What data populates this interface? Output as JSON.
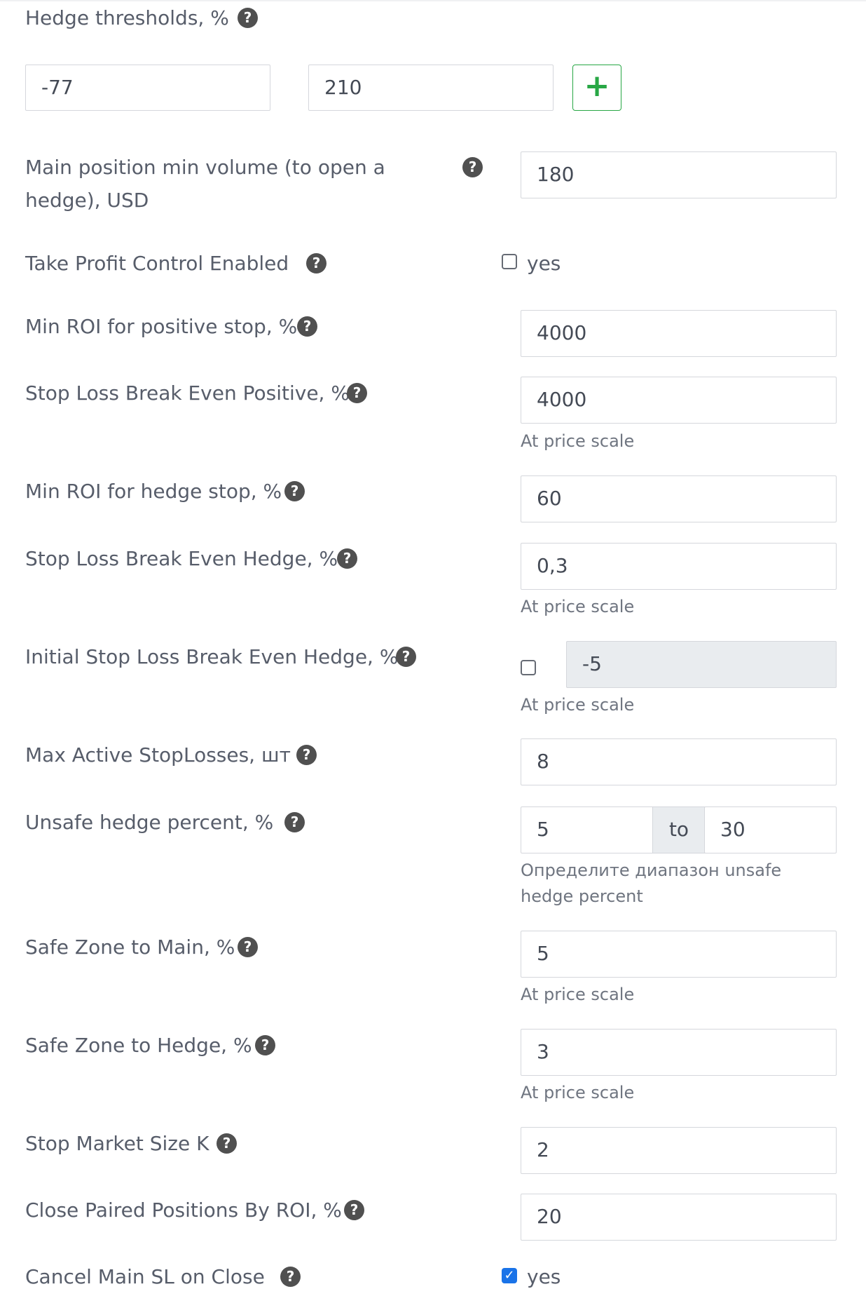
{
  "form": {
    "hedge_thresholds": {
      "label": "Hedge thresholds, %",
      "help_icon": "question-circle-icon",
      "value_1": "-77",
      "value_2": "210",
      "add_button_icon": "plus-icon",
      "add_button_color": "#28a745"
    },
    "main_position_min_volume": {
      "label": "Main position min volume (to open a hedge), USD",
      "value": "180"
    },
    "take_profit_control": {
      "label": "Take Profit Control Enabled",
      "checked": false,
      "checkbox_label": "yes"
    },
    "min_roi_positive_stop": {
      "label": "Min ROI for positive stop, %",
      "value": "4000"
    },
    "stop_loss_be_positive": {
      "label": "Stop Loss Break Even Positive, %",
      "value": "4000",
      "hint": "At price scale"
    },
    "min_roi_hedge_stop": {
      "label": "Min ROI for hedge stop, %",
      "value": "60"
    },
    "stop_loss_be_hedge": {
      "label": "Stop Loss Break Even Hedge, %",
      "value": "0,3",
      "hint": "At price scale"
    },
    "initial_stop_loss_be_hedge": {
      "label": "Initial Stop Loss Break Even Hedge, %",
      "checked": false,
      "value": "-5",
      "disabled": true,
      "hint": "At price scale"
    },
    "max_active_stoplosses": {
      "label": "Max Active StopLosses, шт",
      "value": "8"
    },
    "unsafe_hedge_percent": {
      "label": "Unsafe hedge percent, %",
      "from": "5",
      "separator": "to",
      "to": "30",
      "hint": "Определите диапазон unsafe hedge percent"
    },
    "safe_zone_main": {
      "label": "Safe Zone to Main, %",
      "value": "5",
      "hint": "At price scale"
    },
    "safe_zone_hedge": {
      "label": "Safe Zone to Hedge, %",
      "value": "3",
      "hint": "At price scale"
    },
    "stop_market_size_k": {
      "label": "Stop Market Size K",
      "value": "2"
    },
    "close_paired_by_roi": {
      "label": "Close Paired Positions By ROI, %",
      "value": "20"
    },
    "cancel_main_sl_on_close": {
      "label": "Cancel Main SL on Close",
      "checked": true,
      "checkbox_label": "yes"
    }
  },
  "colors": {
    "help_icon_bg": "#505050",
    "checkbox_checked": "#1a73e8",
    "disabled_input_bg": "#e9ecef"
  }
}
